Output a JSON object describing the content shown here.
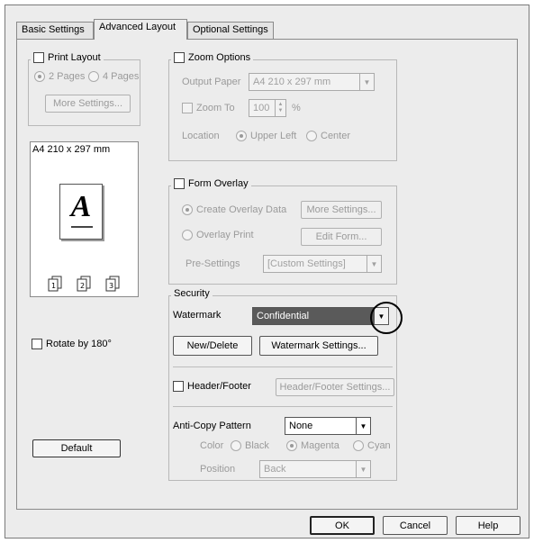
{
  "tabs": [
    {
      "label": "Basic Settings"
    },
    {
      "label": "Advanced Layout"
    },
    {
      "label": "Optional Settings"
    }
  ],
  "print_layout": {
    "label": "Print Layout",
    "option_2": "2 Pages",
    "option_4": "4 Pages",
    "more_settings": "More Settings..."
  },
  "preview": {
    "paper_label": "A4 210 x 297 mm",
    "letter": "A"
  },
  "rotate_label": "Rotate by 180°",
  "default_button": "Default",
  "zoom": {
    "label": "Zoom Options",
    "output_paper_label": "Output Paper",
    "output_paper_value": "A4 210 x 297 mm",
    "zoom_to_label": "Zoom To",
    "zoom_value": "100",
    "percent": "%",
    "location_label": "Location",
    "upper_left": "Upper Left",
    "center": "Center"
  },
  "form_overlay": {
    "label": "Form Overlay",
    "create_data": "Create Overlay Data",
    "more_settings": "More Settings...",
    "overlay_print": "Overlay Print",
    "edit_form": "Edit Form...",
    "presettings_label": "Pre-Settings",
    "presettings_value": "[Custom Settings]"
  },
  "security": {
    "label": "Security",
    "watermark_label": "Watermark",
    "watermark_value": "Confidential",
    "new_delete": "New/Delete",
    "watermark_settings": "Watermark Settings...",
    "header_footer_label": "Header/Footer",
    "header_footer_settings": "Header/Footer Settings...",
    "anticopy_label": "Anti-Copy Pattern",
    "anticopy_value": "None",
    "color_label": "Color",
    "black": "Black",
    "magenta": "Magenta",
    "cyan": "Cyan",
    "position_label": "Position",
    "position_value": "Back"
  },
  "footer": {
    "ok": "OK",
    "cancel": "Cancel",
    "help": "Help"
  },
  "colors": {
    "watermark_fill": "#5a5a5a",
    "dialog_bg": "#ececec"
  }
}
